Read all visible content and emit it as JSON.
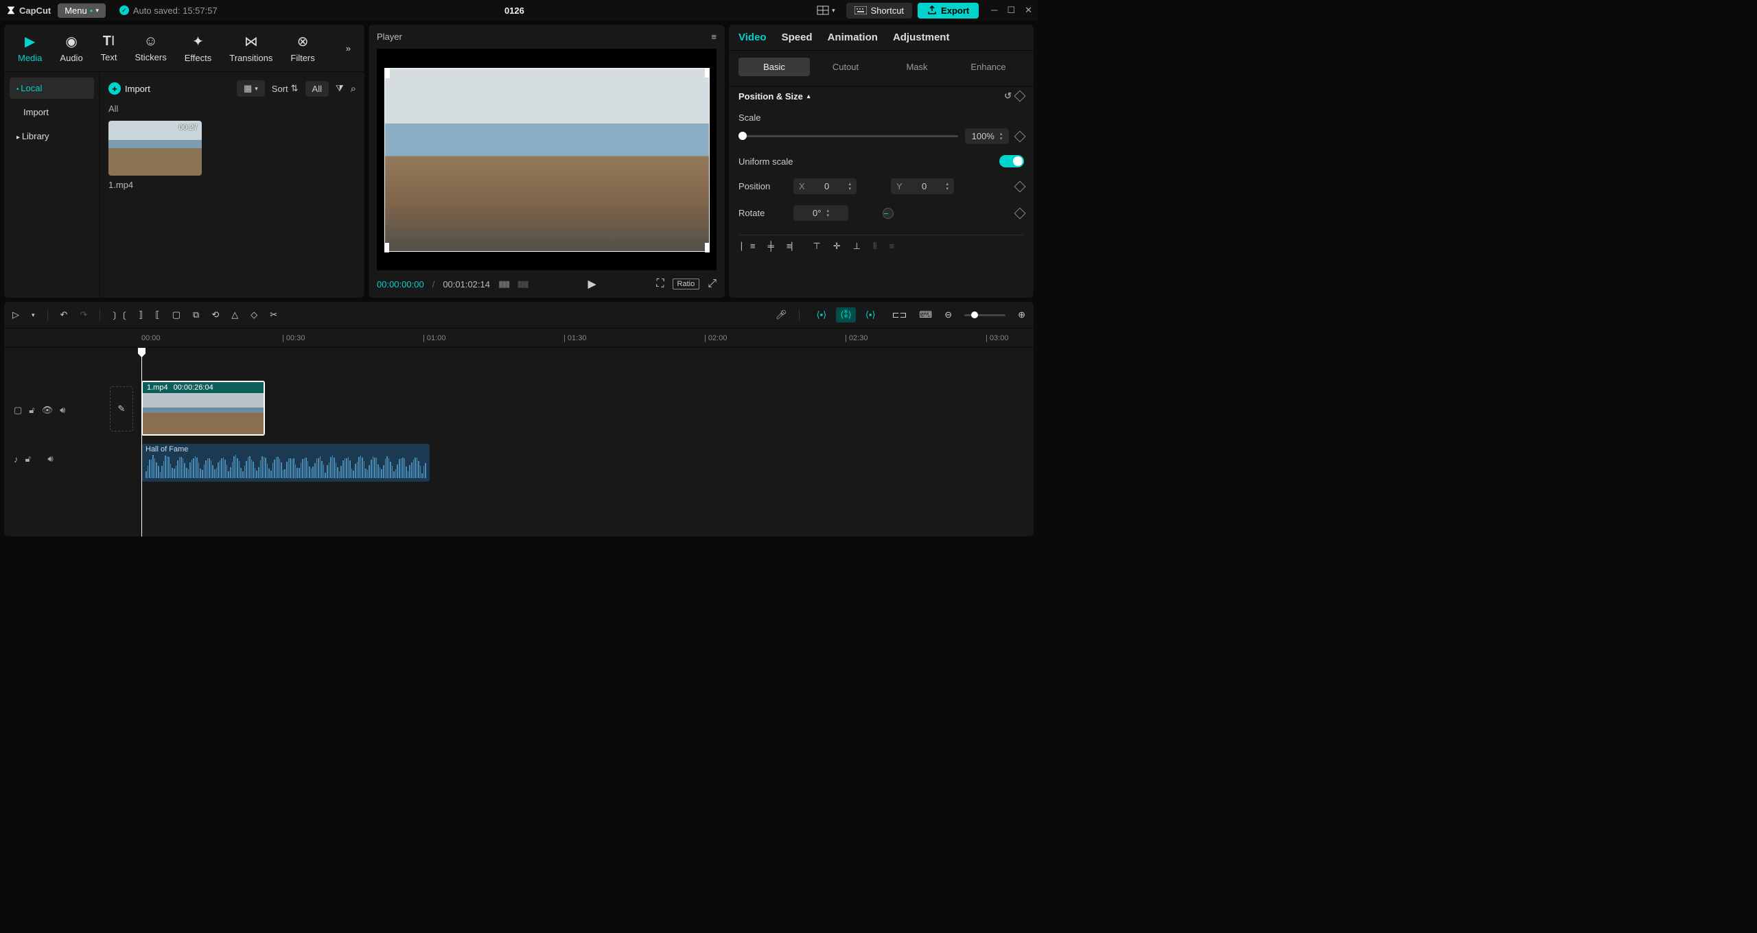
{
  "app": {
    "name": "CapCut",
    "menu_label": "Menu",
    "autosave": "Auto saved: 15:57:57",
    "project_title": "0126"
  },
  "title_right": {
    "shortcut": "Shortcut",
    "export": "Export"
  },
  "toptabs": [
    "Media",
    "Audio",
    "Text",
    "Stickers",
    "Effects",
    "Transitions",
    "Filters"
  ],
  "sidebar": {
    "items": [
      "Local",
      "Import",
      "Library"
    ]
  },
  "media": {
    "import": "Import",
    "sort": "Sort",
    "all": "All",
    "section": "All",
    "clip": {
      "duration": "00:27",
      "name": "1.mp4"
    }
  },
  "player": {
    "title": "Player",
    "tc_current": "00:00:00:00",
    "tc_total": "00:01:02:14",
    "ratio": "Ratio"
  },
  "inspect": {
    "tabs": [
      "Video",
      "Speed",
      "Animation",
      "Adjustment"
    ],
    "subtabs": [
      "Basic",
      "Cutout",
      "Mask",
      "Enhance"
    ],
    "group": "Position & Size",
    "scale_label": "Scale",
    "scale_value": "100%",
    "uniform_label": "Uniform scale",
    "position_label": "Position",
    "pos_x_label": "X",
    "pos_x": "0",
    "pos_y_label": "Y",
    "pos_y": "0",
    "rotate_label": "Rotate",
    "rotate_value": "0°"
  },
  "timeline": {
    "marks": [
      "00:00",
      "| 00:30",
      "| 01:00",
      "| 01:30",
      "| 02:00",
      "| 02:30",
      "| 03:00"
    ],
    "clip_name": "1.mp4",
    "clip_dur": "00:00:26:04",
    "audio_name": "Hall of Fame"
  }
}
